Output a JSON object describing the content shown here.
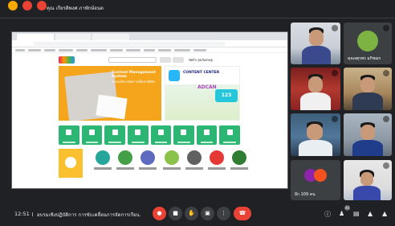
{
  "top": {
    "presenting_text": "คุณ เกียรติพงศ ภาพักษ์อนต"
  },
  "share": {
    "browser_user": "ชัยกิจ สุขภิเศรษฐ",
    "cms_title": "Content Management System",
    "cms_subtitle": "ระบบบริหารจัดการเนื้อหาดิจิทัล",
    "content_center": "CONTENT CENTER",
    "banner_word": "ADCAN",
    "banner_num": "123"
  },
  "participants": {
    "tile2_name": "คุณจตุรพร อภิชฌร",
    "more_count": "อีก 109 คน"
  },
  "bottom": {
    "time": "12:51",
    "meeting_title": "อบรมเชิงปฏิบัติการ การขับเคลื่อนการจัดการเรียน...",
    "participant_badge": "40"
  },
  "colors": {
    "background": "#202124",
    "tile": "#3c4043",
    "red": "#ea4335",
    "green_tile": "#2bb673",
    "banner_orange": "#f4a51c"
  },
  "icons": [
    "microphone-off-icon",
    "camera-off-icon",
    "raise-hand-icon",
    "present-icon",
    "more-options-icon",
    "end-call-icon",
    "info-icon",
    "people-icon",
    "chat-icon",
    "activities-icon",
    "lock-icon"
  ]
}
